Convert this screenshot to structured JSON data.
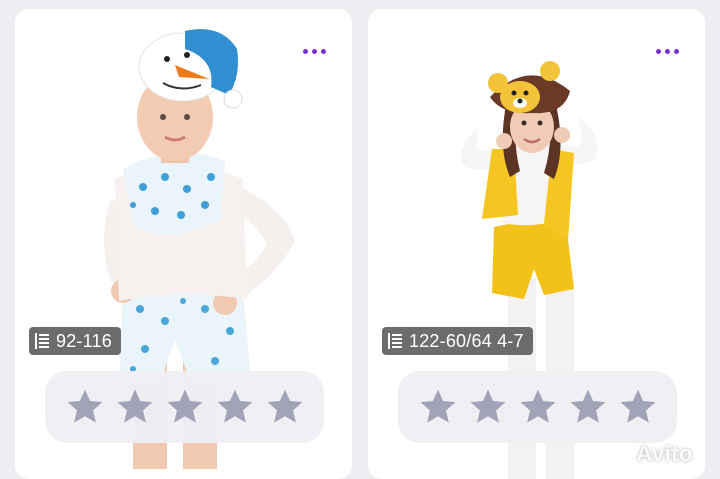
{
  "cards": [
    {
      "size_label": "92-116",
      "rating_max": 5,
      "rating_value": 0
    },
    {
      "size_label": "122-60/64 4-7",
      "rating_max": 5,
      "rating_value": 0
    }
  ],
  "watermark": {
    "brand": "Avito"
  },
  "colors": {
    "accent": "#7a2fd6",
    "star": "#a3a3b8",
    "badge": "#5f5f5f"
  },
  "icons": {
    "more": "more-dots-icon",
    "size": "list-icon",
    "star": "star-icon"
  }
}
